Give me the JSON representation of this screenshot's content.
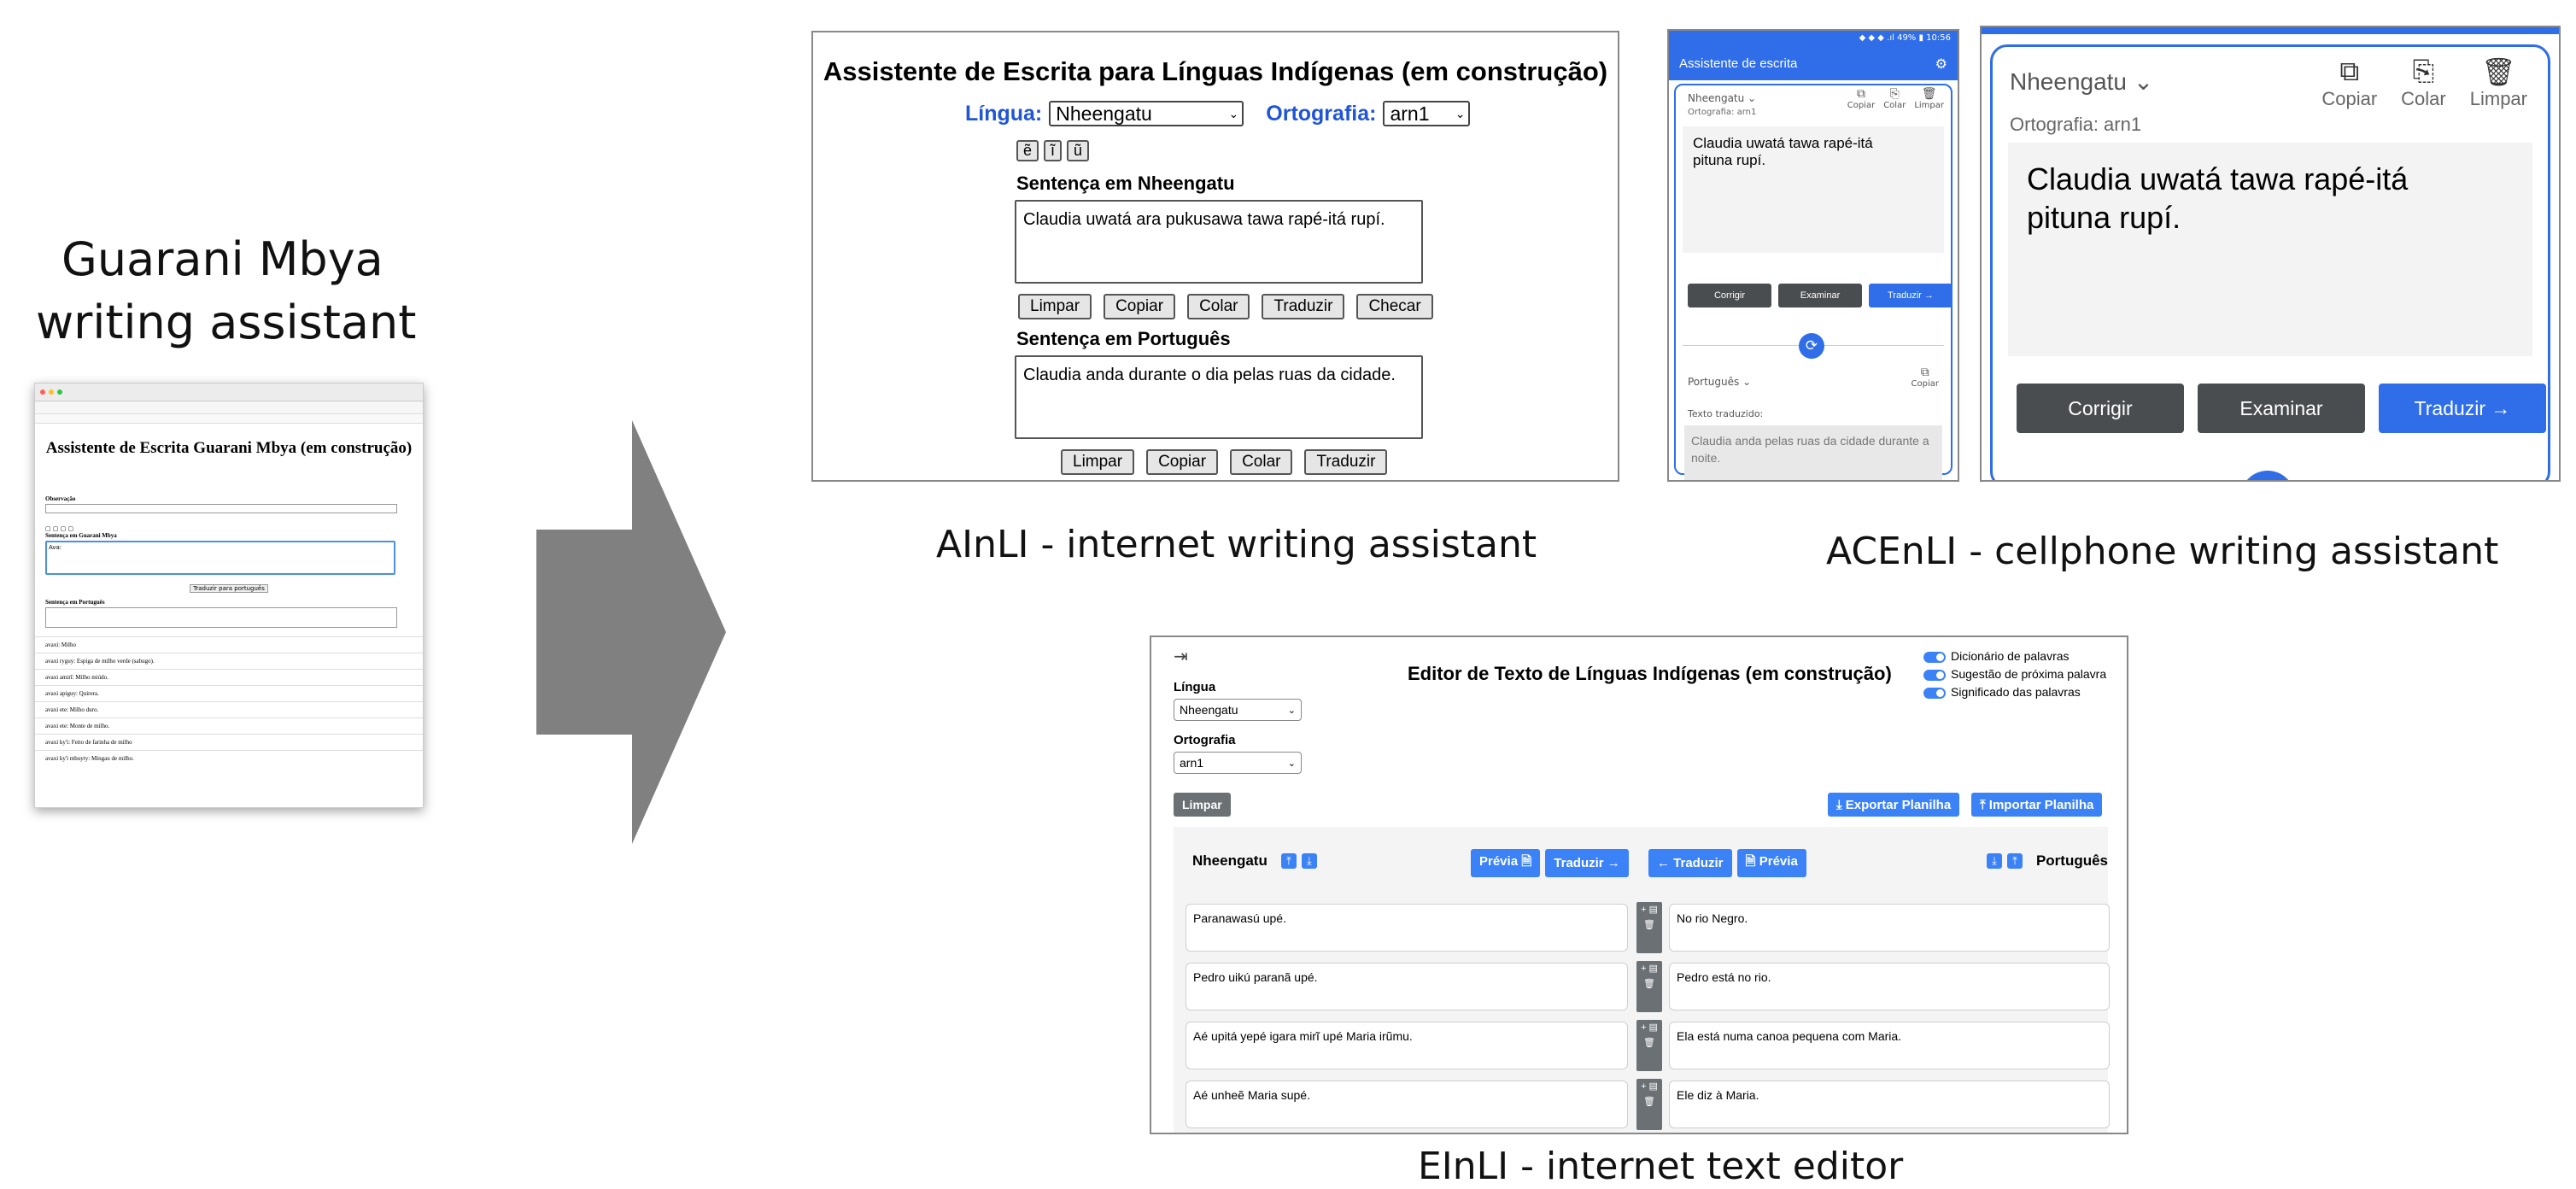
{
  "left": {
    "heading_line1": "Guarani Mbya",
    "heading_line2": "writing assistant",
    "thumb": {
      "title": "Assistente de Escrita Guarani Mbya (em construção)",
      "observacao": "Observação",
      "sentence_label": "Sentença em Guarani Mbya",
      "input_value": "Avaː",
      "translate_btn": "Traduzir para português",
      "pt_label": "Sentença em Português",
      "entries": [
        "avaxi: Milho",
        "avaxi ryguy: Espiga de milho verde (sabugo).",
        "avaxi amirĩ: Milho miúdo.",
        "avaxi apiguy: Quirera.",
        "avaxi ete: Milho duro.",
        "avaxi ete: Monte de milho.",
        "avaxi ky'i: Feito de farinha de milho",
        "avaxi ky'i mbuyty: Mingau de milho."
      ]
    }
  },
  "ainli": {
    "caption": "AInLI - internet writing assistant",
    "title": "Assistente de Escrita para Línguas Indígenas (em construção)",
    "lingua_label": "Língua:",
    "lingua_value": "Nheengatu",
    "ortografia_label": "Ortografia:",
    "ortografia_value": "arn1",
    "chars": [
      "ẽ",
      "ĩ",
      "ũ"
    ],
    "sentence_label": "Sentença em Nheengatu",
    "sentence_value": "Claudia uwatá ara pukusawa tawa rapé-itá rupí.",
    "buttons1": [
      "Limpar",
      "Copiar",
      "Colar",
      "Traduzir",
      "Checar"
    ],
    "pt_label": "Sentença em Português",
    "pt_value": "Claudia anda durante o dia pelas ruas da cidade.",
    "buttons2": [
      "Limpar",
      "Copiar",
      "Colar",
      "Traduzir"
    ]
  },
  "acenli": {
    "caption": "ACEnLI - cellphone writing assistant",
    "status": "◆ ◆ ◆ .ıl 49% ▮ 10:56",
    "app_title": "Assistente de escrita",
    "lang": "Nheengatu",
    "ortho": "Ortografia: arn1",
    "copy": "Copiar",
    "paste": "Colar",
    "clear": "Limpar",
    "text": "Claudia uwatá tawa rapé-itá pituna rupí.",
    "corrigir": "Corrigir",
    "examinar": "Examinar",
    "traduzir": "Traduzir →",
    "pt_lang": "Português",
    "translated_label": "Texto traduzido:",
    "translated": "Claudia anda pelas ruas da cidade durante a noite."
  },
  "einli": {
    "caption": "EInLI - internet text editor",
    "title": "Editor de Texto de Línguas Indígenas (em construção)",
    "lingua_label": "Língua",
    "lingua_value": "Nheengatu",
    "orto_label": "Ortografia",
    "orto_value": "arn1",
    "toggles": [
      "Dicionário de palavras",
      "Sugestão de próxima palavra",
      "Significado das palavras"
    ],
    "limpar": "Limpar",
    "export": "⤓ Exportar Planilha",
    "import": "⤒ Importar Planilha",
    "left_lang": "Nheengatu",
    "right_lang": "Português",
    "previa": "Prévia",
    "traduzir_r": "Traduzir →",
    "traduzir_l": "← Traduzir",
    "rows": [
      {
        "src": "Paranawasú upé.",
        "tgt": "No rio Negro."
      },
      {
        "src": "Pedro uikú paranã upé.",
        "tgt": "Pedro está no rio."
      },
      {
        "src": "Aé upitá yepé igara mirĩ upé Maria irũmu.",
        "tgt": "Ela está numa canoa pequena com Maria."
      },
      {
        "src": "Aé unheẽ Maria supé.",
        "tgt": "Ele diz à Maria."
      }
    ]
  },
  "colors": {
    "arrow": "#808080",
    "blue": "#1f55d6",
    "app_blue": "#2f6ee8",
    "dark_btn": "#4a4d50"
  }
}
